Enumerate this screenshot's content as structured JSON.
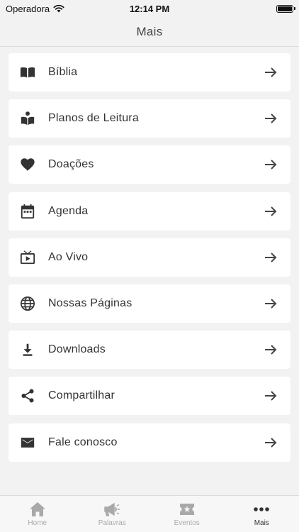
{
  "status_bar": {
    "carrier": "Operadora",
    "time": "12:14 PM"
  },
  "header": {
    "title": "Mais"
  },
  "menu": [
    {
      "label": "Bíblia",
      "icon": "book-icon"
    },
    {
      "label": "Planos de Leitura",
      "icon": "reading-plan-icon"
    },
    {
      "label": "Doações",
      "icon": "heart-icon"
    },
    {
      "label": "Agenda",
      "icon": "calendar-icon"
    },
    {
      "label": "Ao Vivo",
      "icon": "live-tv-icon"
    },
    {
      "label": "Nossas Páginas",
      "icon": "globe-icon"
    },
    {
      "label": "Downloads",
      "icon": "download-icon"
    },
    {
      "label": "Compartilhar",
      "icon": "share-icon"
    },
    {
      "label": "Fale conosco",
      "icon": "mail-icon"
    }
  ],
  "tab_bar": {
    "active": "Mais",
    "tabs": [
      {
        "label": "Home",
        "icon": "home-icon"
      },
      {
        "label": "Palavras",
        "icon": "megaphone-icon"
      },
      {
        "label": "Eventos",
        "icon": "ticket-icon"
      },
      {
        "label": "Mais",
        "icon": "more-dots-icon"
      }
    ]
  },
  "colors": {
    "background": "#f2f2f2",
    "card": "#ffffff",
    "text": "#333333",
    "inactive_tab": "#a9a9a9"
  }
}
